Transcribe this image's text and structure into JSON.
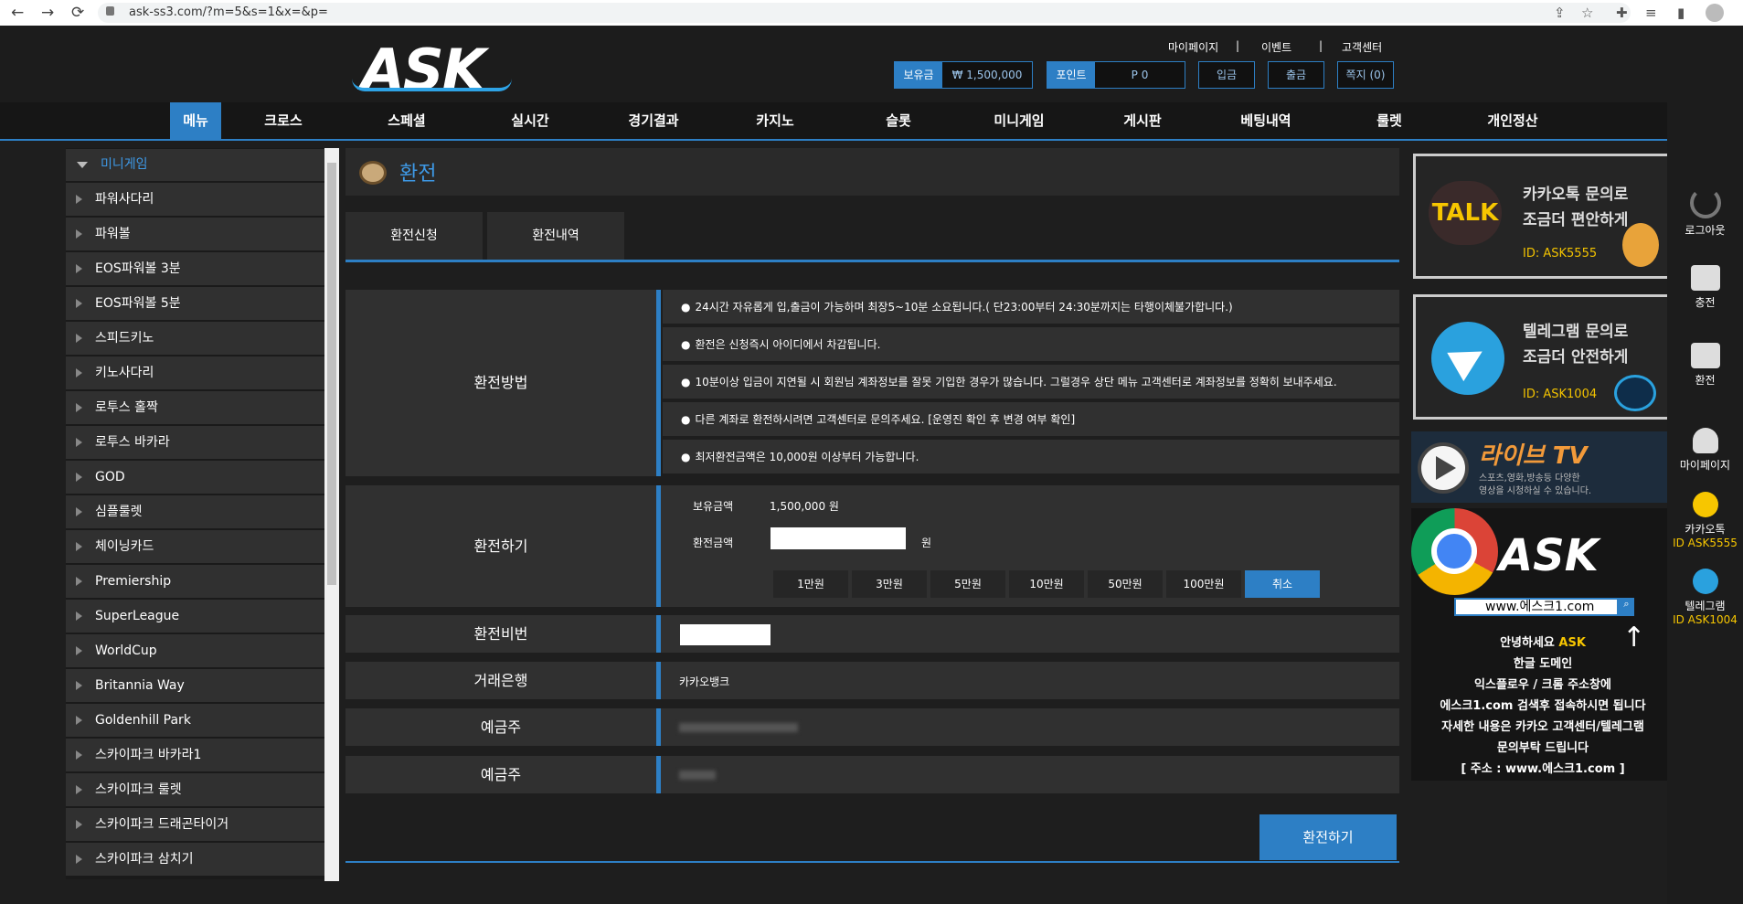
{
  "browser": {
    "url": "ask-ss3.com/?m=5&s=1&x=&p=",
    "back": "←",
    "forward": "→",
    "reload": "⟳"
  },
  "header": {
    "logo": "ASK",
    "top_links": [
      "마이페이지",
      "|",
      "이벤트",
      "|",
      "고객센터"
    ],
    "balance_label": "보유금",
    "balance_value": "₩ 1,500,000",
    "point_label": "포인트",
    "point_value": "P 0",
    "deposit": "입금",
    "withdraw": "출금",
    "message": "쪽지 (0)"
  },
  "menu": [
    "메뉴",
    "크로스",
    "스페셜",
    "실시간",
    "경기결과",
    "카지노",
    "슬롯",
    "미니게임",
    "게시판",
    "베팅내역",
    "룰렛",
    "개인정산"
  ],
  "sidebar": {
    "head": "미니게임",
    "items": [
      "파워사다리",
      "파워볼",
      "EOS파워볼 3분",
      "EOS파워볼 5분",
      "스피드키노",
      "키노사다리",
      "로투스 홀짝",
      "로투스 바카라",
      "GOD",
      "심플룰렛",
      "체이닝카드",
      "Premiership",
      "SuperLeague",
      "WorldCup",
      "Britannia Way",
      "Goldenhill Park",
      "스카이파크 바카라1",
      "스카이파크 룰렛",
      "스카이파크 드래곤타이거",
      "스카이파크 삼치기"
    ]
  },
  "content": {
    "title": "환전",
    "tabs": [
      "환전신청",
      "환전내역"
    ],
    "method_label": "환전방법",
    "notices": [
      "24시간 자유롭게 입,출금이 가능하며 최장5~10분 소요됩니다.( 단23:00부터 24:30분까지는 타행이체불가합니다.)",
      "환전은 신청즉시 아이디에서 차감됩니다.",
      "10분이상 입금이 지연될 시 회원님 계좌정보를 잘못 기입한 경우가 많습니다. 그럴경우 상단 메뉴 고객센터로 계좌정보를 정확히 보내주세요.",
      "다른 계좌로 환전하시려면 고객센터로 문의주세요. [운영진 확인 후 변경 여부 확인]",
      "최저환전금액은 10,000원 이상부터 가능합니다."
    ],
    "exchange_label": "환전하기",
    "holding_label": "보유금액",
    "holding_value": "1,500,000 원",
    "amount_label": "환전금액",
    "amount_value": "",
    "won": "원",
    "amount_buttons": [
      "1만원",
      "3만원",
      "5만원",
      "10만원",
      "50만원",
      "100만원"
    ],
    "cancel": "취소",
    "pin_label": "환전비번",
    "bank_label": "거래은행",
    "bank_value": "카카오뱅크",
    "holder_label_1": "예금주",
    "holder_value_1": "",
    "holder_label_2": "예금주",
    "holder_value_2": "",
    "submit": "환전하기"
  },
  "banners": {
    "kakao_badge": "TALK",
    "kakao_line1": "카카오톡 문의로",
    "kakao_line2": "조금더 편안하게",
    "kakao_id": "ID: ASK5555",
    "tg_line1": "텔레그램 문의로",
    "tg_line2": "조금더 안전하게",
    "tg_id": "ID: ASK1004",
    "live_title": "라이브 TV",
    "live_sub1": "스포츠,영화,방송등 다양한",
    "live_sub2": "영상을 시청하실 수 있습니다.",
    "chrome_brand": "ASK",
    "chrome_url": "www.에스크1.com",
    "greet_a": "안녕하세요 ",
    "greet_b": "ASK",
    "lines": [
      "한글 도메인",
      "익스플로우 / 크롬 주소창에",
      "에스크1.com 검색후 접속하시면 됩니다",
      "자세한 내용은 카카오 고객센터/텔레그램",
      "문의부탁 드립니다",
      "[ 주소 : www.에스크1.com ]"
    ]
  },
  "right_bar": {
    "logout": "로그아웃",
    "charge": "충전",
    "exchange": "환전",
    "mypage": "마이페이지",
    "kakao": "카카오톡",
    "kakao_id": "ID ASK5555",
    "telegram": "텔레그램",
    "telegram_id": "ID ASK1004"
  }
}
